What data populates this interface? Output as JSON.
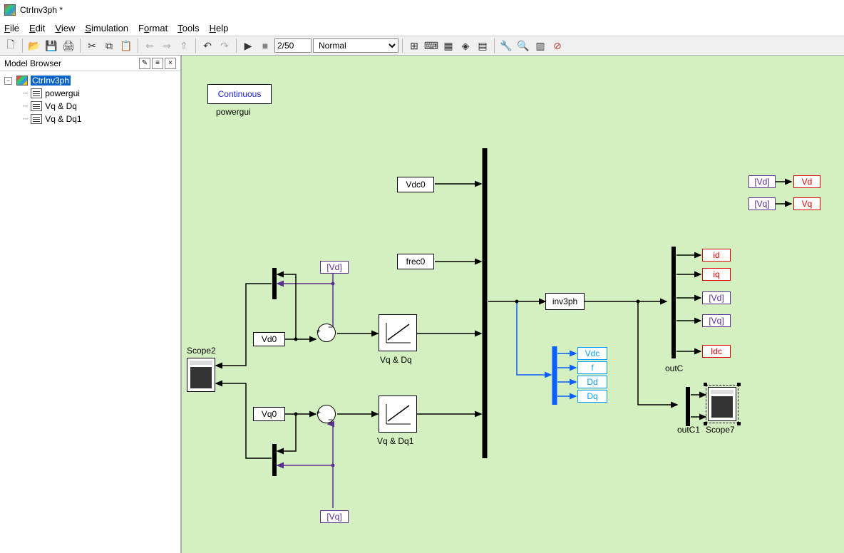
{
  "title": "CtrInv3ph *",
  "menu": {
    "file": "File",
    "edit": "Edit",
    "view": "View",
    "sim": "Simulation",
    "format": "Format",
    "tools": "Tools",
    "help": "Help"
  },
  "toolbar": {
    "step": "2/50",
    "mode": "Normal"
  },
  "sidebar": {
    "header": "Model Browser",
    "root": "CtrInv3ph",
    "items": [
      "powergui",
      "Vq & Dq",
      "Vq & Dq1"
    ]
  },
  "blocks": {
    "powergui_content": "Continuous",
    "powergui_label": "powergui",
    "vdc0": "Vdc0",
    "frec0": "frec0",
    "vd0": "Vd0",
    "vq0": "Vq0",
    "vqdq": "Vq & Dq",
    "vqdq1": "Vq & Dq1",
    "scope2": "Scope2",
    "inv3ph": "inv3ph",
    "outc": "outC",
    "outc1": "outC1",
    "scope7": "Scope7",
    "bus": {
      "vdc": "Vdc",
      "f": "f",
      "dd": "Dd",
      "dq": "Dq"
    },
    "outs": {
      "id": "id",
      "iq": "iq",
      "vd": "[Vd]",
      "vq": "[Vq]",
      "idc": "Idc"
    },
    "top_vd": "Vd",
    "top_vq": "Vq",
    "from_vd": "[Vd]",
    "from_vq": "[Vq]",
    "goto_vd": "[Vd]",
    "goto_vq": "[Vq]"
  }
}
